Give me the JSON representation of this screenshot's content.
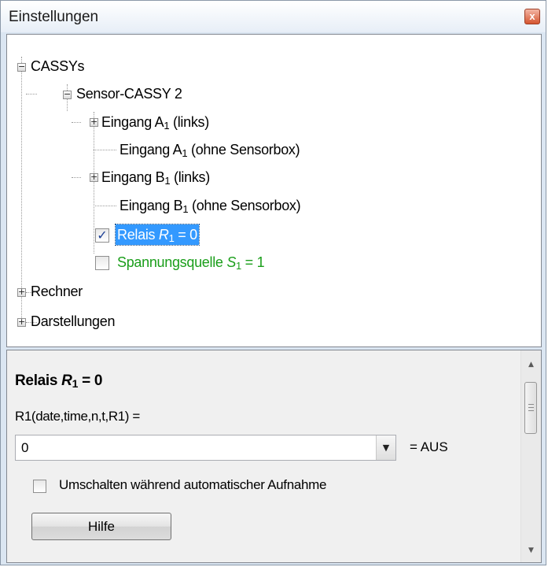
{
  "window": {
    "title": "Einstellungen",
    "close_glyph": "x"
  },
  "tree": {
    "root": "CASSYs",
    "device": "Sensor-CASSY 2",
    "eingang_a_links": {
      "pre": "Eingang A",
      "sub": "1",
      "post": " (links)"
    },
    "eingang_a_ohne": {
      "pre": "Eingang A",
      "sub": "1",
      "post": " (ohne Sensorbox)"
    },
    "eingang_b_links": {
      "pre": "Eingang B",
      "sub": "1",
      "post": " (links)"
    },
    "eingang_b_ohne": {
      "pre": "Eingang B",
      "sub": "1",
      "post": " (ohne Sensorbox)"
    },
    "relais": {
      "pre": "Relais ",
      "sym": "R",
      "sub": "1",
      "post": " = 0",
      "checked": true
    },
    "spannungsquelle": {
      "pre": "Spannungsquelle ",
      "sym": "S",
      "sub": "1",
      "post": " = 1",
      "checked": false
    },
    "rechner": "Rechner",
    "darstellungen": "Darstellungen",
    "expand_glyph": "+",
    "collapse_glyph": "−",
    "check_glyph": "✓"
  },
  "properties": {
    "title": {
      "pre": "Relais ",
      "sym": "R",
      "sub": "1",
      "post": " = 0"
    },
    "formula_label": "R1(date,time,n,t,R1) =",
    "formula_value": "0",
    "combo_arrow": "▼",
    "formula_suffix": "= AUS",
    "auto_toggle_label": "Umschalten während automatischer Aufnahme",
    "help_label": "Hilfe"
  },
  "scrollbar": {
    "up_glyph": "▲",
    "down_glyph": "▼"
  },
  "colors": {
    "selection": "#3399ff",
    "green_text": "#1a9e1a",
    "close_button": "#d5552f"
  }
}
